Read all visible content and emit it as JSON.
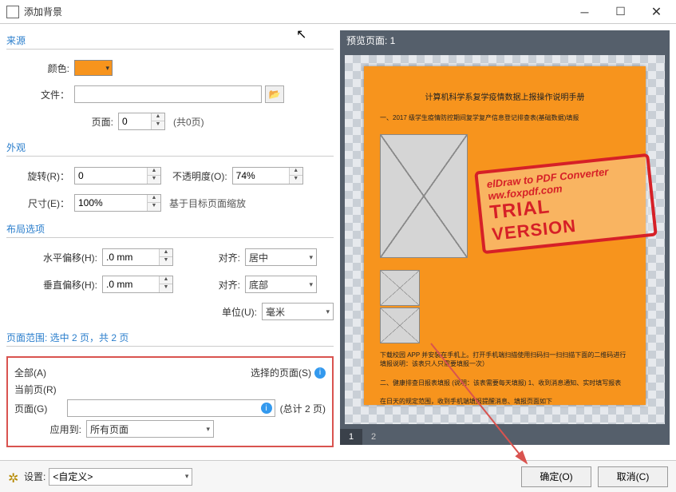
{
  "titlebar": {
    "title": "添加背景"
  },
  "source": {
    "header": "来源",
    "color_label": "颜色:",
    "color_value": "#f7941d",
    "file_label": "文件：",
    "file_value": "",
    "page_label": "页面:",
    "page_value": "0",
    "page_total": "(共0页)"
  },
  "appearance": {
    "header": "外观",
    "rotate_label": "旋转(R)：",
    "rotate_value": "0",
    "opacity_label": "不透明度(O):",
    "opacity_value": "74%",
    "scale_label": "尺寸(E)：",
    "scale_value": "100%",
    "scale_note": "基于目标页面缩放"
  },
  "layout": {
    "header": "布局选项",
    "hoff_label": "水平偏移(H):",
    "hoff_value": ".0 mm",
    "halign_label": "对齐:",
    "halign_value": "居中",
    "voff_label": "垂直偏移(H):",
    "voff_value": ".0 mm",
    "valign_label": "对齐:",
    "valign_value": "底部",
    "unit_label": "单位(U):",
    "unit_value": "毫米"
  },
  "range": {
    "header": "页面范围: 选中 2 页，共 2 页",
    "all": "全部(A)",
    "selected": "选择的页面(S)",
    "current": "当前页(R)",
    "pages_label": "页面(G)",
    "pages_value": "",
    "pages_total": "(总计 2 页)",
    "apply_label": "应用到:",
    "apply_value": "所有页面"
  },
  "preview": {
    "header": "预览页面: 1",
    "doc_title": "计算机科学系复学疫情数据上报操作说明手册",
    "line1": "一、2017 级学生疫情防控期间复学复产信息登记排查表(基础数据)填报",
    "line2": "下载校园 APP 并安装在手机上。打开手机端扫描使用扫码扫一扫扫描下面的二维码进行填报说明：该表只人只需要填报一次）",
    "line3": "二、健康排查日报表填报 (说明：该表需要每天填报) 1、收到消息通知、实时填写报表",
    "line4": "在日天的规定范围，收到手机端填报提醒消息、填报页面如下",
    "stamp1": "elDraw to PDF Converter",
    "stamp2": "ww.foxpdf.com",
    "stamp3": "TRIAL",
    "stamp4": "VERSION",
    "tab1": "1",
    "tab2": "2"
  },
  "footer": {
    "settings_label": "设置:",
    "settings_value": "<自定义>",
    "ok": "确定(O)",
    "cancel": "取消(C)"
  }
}
